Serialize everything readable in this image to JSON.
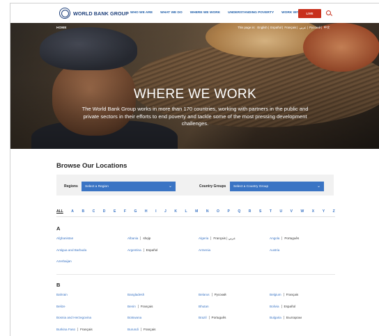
{
  "header": {
    "logo_text": "WORLD BANK GROUP",
    "nav": [
      "WHO WE ARE",
      "WHAT WE DO",
      "WHERE WE WORK",
      "UNDERSTANDING POVERTY",
      "WORK WITH US"
    ],
    "live_label": "LIVE",
    "accent_color": "#c8301c",
    "brand_color": "#1d3f7a"
  },
  "hero": {
    "breadcrumb": "HOME",
    "lang_prefix": "This page in:",
    "languages": [
      "English",
      "Español",
      "Français",
      "عربي",
      "Русский",
      "中文"
    ],
    "title": "WHERE WE WORK",
    "subtitle": "The World Bank Group works in more than 170 countries, working with partners in the public and private sectors in their efforts to end poverty and tackle some of the most pressing development challenges."
  },
  "browse": {
    "title": "Browse Our Locations",
    "regions_label": "Regions",
    "regions_placeholder": "Select a Region",
    "groups_label": "Country Groups",
    "groups_placeholder": "Select a Country Group"
  },
  "alphabet": [
    "ALL",
    "A",
    "B",
    "C",
    "D",
    "E",
    "F",
    "G",
    "H",
    "I",
    "J",
    "K",
    "L",
    "M",
    "N",
    "O",
    "P",
    "Q",
    "R",
    "S",
    "T",
    "U",
    "V",
    "W",
    "X",
    "Y",
    "Z"
  ],
  "sections": [
    {
      "letter": "A",
      "countries": [
        {
          "name": "Afghanistan",
          "alt": ""
        },
        {
          "name": "Albania",
          "alt": "shqip"
        },
        {
          "name": "Algeria",
          "alt": "Français | عربي"
        },
        {
          "name": "Angola",
          "alt": "Português"
        },
        {
          "name": "Antigua and Barbuda",
          "alt": ""
        },
        {
          "name": "Argentina",
          "alt": "Español"
        },
        {
          "name": "Armenia",
          "alt": ""
        },
        {
          "name": "Austria",
          "alt": ""
        },
        {
          "name": "Azerbaijan",
          "alt": ""
        }
      ]
    },
    {
      "letter": "B",
      "countries": [
        {
          "name": "Bahrain",
          "alt": ""
        },
        {
          "name": "Bangladesh",
          "alt": ""
        },
        {
          "name": "Belarus",
          "alt": "Русский"
        },
        {
          "name": "Belgium",
          "alt": "Français"
        },
        {
          "name": "Belize",
          "alt": ""
        },
        {
          "name": "Benin",
          "alt": "Français"
        },
        {
          "name": "Bhutan",
          "alt": ""
        },
        {
          "name": "Bolivia",
          "alt": "Español"
        },
        {
          "name": "Bosnia and Herzegovina",
          "alt": ""
        },
        {
          "name": "Botswana",
          "alt": ""
        },
        {
          "name": "Brazil",
          "alt": "Português"
        },
        {
          "name": "Bulgaria",
          "alt": "Български"
        },
        {
          "name": "Burkina Faso",
          "alt": "Français"
        },
        {
          "name": "Burundi",
          "alt": "Français"
        }
      ]
    }
  ]
}
